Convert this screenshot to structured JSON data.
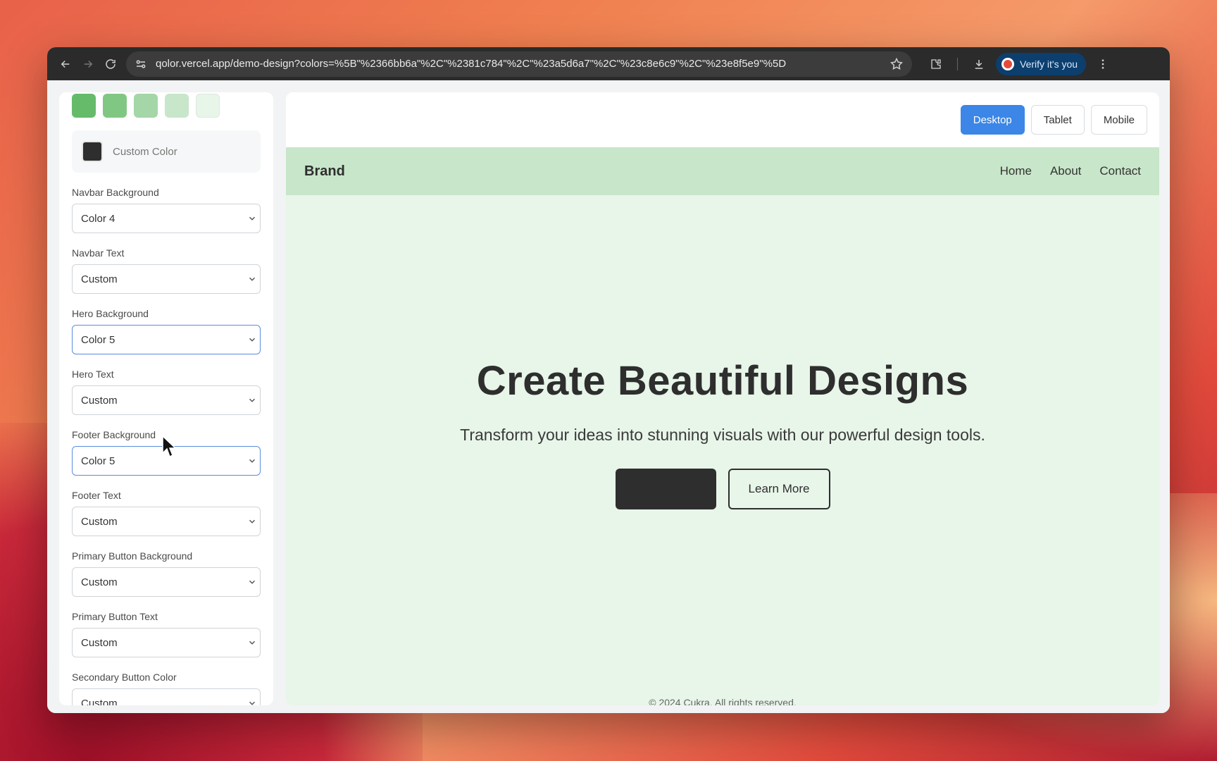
{
  "browser": {
    "url": "qolor.vercel.app/demo-design?colors=%5B\"%2366bb6a\"%2C\"%2381c784\"%2C\"%23a5d6a7\"%2C\"%23c8e6c9\"%2C\"%23e8f5e9\"%5D",
    "verify_label": "Verify it's you"
  },
  "sidebar": {
    "swatches": [
      "#66bb6a",
      "#81c784",
      "#a5d6a7",
      "#c8e6c9",
      "#e8f5e9"
    ],
    "custom_color_label": "Custom Color",
    "fields": [
      {
        "label": "Navbar Background",
        "value": "Color 4"
      },
      {
        "label": "Navbar Text",
        "value": "Custom"
      },
      {
        "label": "Hero Background",
        "value": "Color 5"
      },
      {
        "label": "Hero Text",
        "value": "Custom"
      },
      {
        "label": "Footer Background",
        "value": "Color 5"
      },
      {
        "label": "Footer Text",
        "value": "Custom"
      },
      {
        "label": "Primary Button Background",
        "value": "Custom"
      },
      {
        "label": "Primary Button Text",
        "value": "Custom"
      },
      {
        "label": "Secondary Button Color",
        "value": "Custom"
      }
    ]
  },
  "preview": {
    "devices": [
      "Desktop",
      "Tablet",
      "Mobile"
    ],
    "active_device": "Desktop",
    "brand": "Brand",
    "nav_links": [
      "Home",
      "About",
      "Contact"
    ],
    "hero_title": "Create Beautiful Designs",
    "hero_subtitle": "Transform your ideas into stunning visuals with our powerful design tools.",
    "primary_button_label": "",
    "secondary_button_label": "Learn More",
    "footer_text": "© 2024 Cukra. All rights reserved."
  },
  "colors": {
    "accent": "#3b86e6",
    "navbar_bg": "#c8e6c9",
    "hero_bg": "#e8f5e9",
    "dark": "#2e2e2e"
  }
}
